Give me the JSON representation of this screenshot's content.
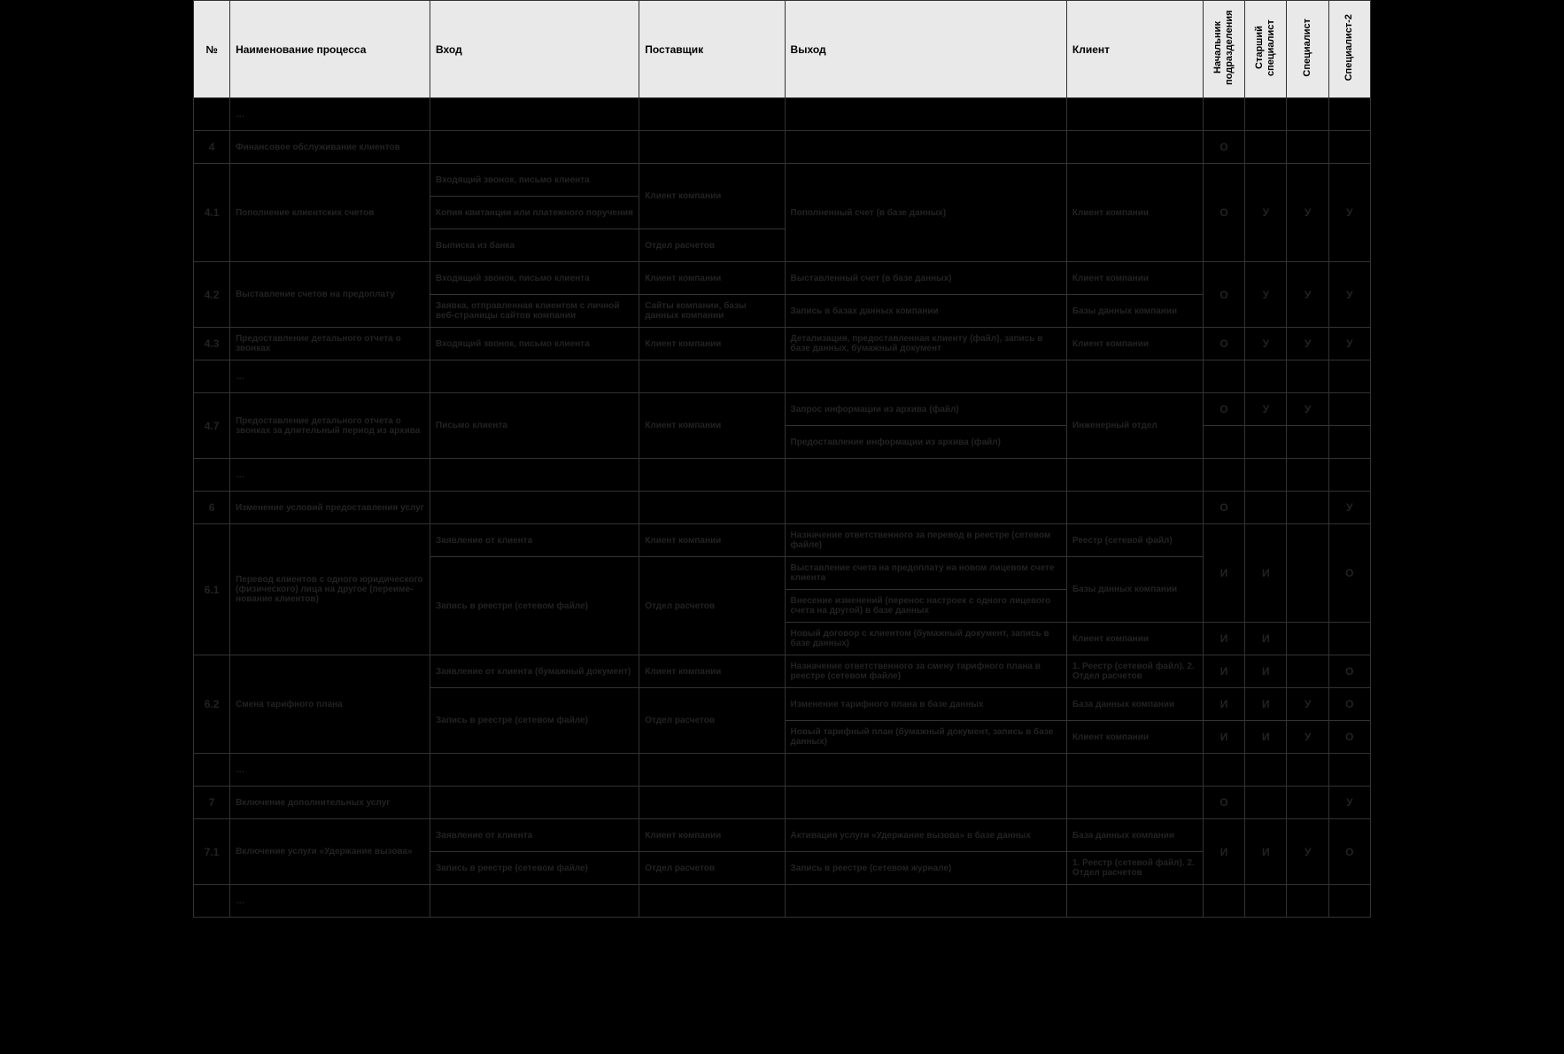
{
  "headers": {
    "num": "№",
    "name": "Наименование процесса",
    "input": "Вход",
    "supplier": "Поставщик",
    "output": "Выход",
    "client": "Клиент",
    "r1": "Начальник подразделения",
    "r2": "Старший специалист",
    "r3": "Специалист",
    "r4": "Специалист-2"
  },
  "ellipsis": "…",
  "rows": {
    "r4": {
      "num": "4",
      "name": "Финансовое обслуживание клиентов",
      "role1": "О"
    },
    "r4_1": {
      "num": "4.1",
      "name": "Пополнение клиентских счетов",
      "in1": "Входящий звонок, письмо клиента",
      "sup1": "Клиент компании",
      "in2": "Копия квитанции или платежного поручения",
      "in3": "Выписка из банка",
      "sup3": "Отдел расчетов",
      "out": "Пополненный счет (в базе данных)",
      "cli": "Клиент компании",
      "role1": "О",
      "role2": "У",
      "role3": "У",
      "role4": "У"
    },
    "r4_2": {
      "num": "4.2",
      "name": "Выставление счетов на предоплату",
      "in1": "Входящий звонок, письмо клиента",
      "sup1": "Клиент компании",
      "out1": "Выставленный счет (в базе данных)",
      "cli1": "Клиент компании",
      "in2": "Заявка, отправленная клиентом с личной веб-страницы сайтов компании",
      "sup2": "Сайты компании, базы данных компании",
      "out2": "Запись в базах данных компании",
      "cli2": "Базы данных  компании",
      "role1": "О",
      "role2": "У",
      "role3": "У",
      "role4": "У"
    },
    "r4_3": {
      "num": "4.3",
      "name": "Предоставление детального отчета о звонках",
      "in": "Входящий звонок, письмо клиента",
      "sup": "Клиент компании",
      "out": "Детализация, предоставленная клиенту (файл), запись в базе данных, бумажный документ",
      "cli": "Клиент компании",
      "role1": "О",
      "role2": "У",
      "role3": "У",
      "role4": "У"
    },
    "r4_7": {
      "num": "4.7",
      "name": "Предоставление детального отчета о звон­ках за длительный период из архива",
      "in": "Письмо клиента",
      "sup": "Клиент компании",
      "out1": "Запрос информации из архива (файл)",
      "cli1": "Инженерный отдел",
      "out2": "Предоставление информации из архива (файл)",
      "role1": "О",
      "role2": "У",
      "role3": "У"
    },
    "r6": {
      "num": "6",
      "name": "Изменение условий предоставления услуг",
      "role1": "О",
      "role4": "У"
    },
    "r6_1": {
      "num": "6.1",
      "name": "Перевод клиентов с одного юридического (физического) лица на другое (переиме­нование клиентов)",
      "in1": "Заявление от клиента",
      "sup1": "Клиент компании",
      "out1": "Назначение ответственного за перевод в реестре (сетевом файле)",
      "cli1": "Реестр (сетевой файл)",
      "in2": "Запись в реестре (сетевом файле)",
      "sup2": "Отдел расчетов",
      "out2": "Выставление счета на предоплату на новом лицевом счете клиента",
      "out3": "Внесение изменений (перенос настроек с одного лицевого счета на другой)  в базе данных",
      "cli23": "Базы данных  компании",
      "out4": "Новый договор с клиентом (бумажный документ, запись в базе данных)",
      "cli4": "Клиент компании",
      "role_a1": "И",
      "role_a2": "И",
      "role_a4": "О",
      "role_b1": "И",
      "role_b2": "И"
    },
    "r6_2": {
      "num": "6.2",
      "name": "Смена тарифного плана",
      "in1": "Заявление от клиента (бумажный документ)",
      "sup1": "Клиент компании",
      "out1": "Назначение ответственного за смену тарифного плана в реестре (сетевом файле)",
      "cli1": "1. Реестр (сетевой файл). 2. Отдел расчетов",
      "in2": "Запись в реестре (сетевом файле)",
      "sup2": "Отдел расчетов",
      "out2": "Изменение тарифного плана  в базе данных",
      "cli2": "База данных компании",
      "out3": "Новый тарифный план (бумажный документ, запись в базе данных)",
      "cli3": "Клиент компании",
      "role_a1": "И",
      "role_a2": "И",
      "role_a4": "О",
      "role_b1": "И",
      "role_b2": "И",
      "role_b3": "У",
      "role_b4": "О",
      "role_c1": "И",
      "role_c2": "И",
      "role_c3": "У",
      "role_c4": "О"
    },
    "r7": {
      "num": "7",
      "name": "Включение дополнительных услуг",
      "role1": "О",
      "role4": "У"
    },
    "r7_1": {
      "num": "7.1",
      "name": "Включение услуги «Удержание вызова»",
      "in1": "Заявление от клиента",
      "sup1": "Клиент компании",
      "out1": "Активация услуги «Удержание вызова» в базе данных",
      "cli1": "База данных компании",
      "in2": "Запись в реестре (сетевом файле)",
      "sup2": "Отдел расчетов",
      "out2": "Запись в реестре (сетевом журнале)",
      "cli2": "1. Реестр (сетевой файл). 2. Отдел расчетов",
      "role1": "И",
      "role2": "И",
      "role3": "У",
      "role4": "О"
    }
  }
}
